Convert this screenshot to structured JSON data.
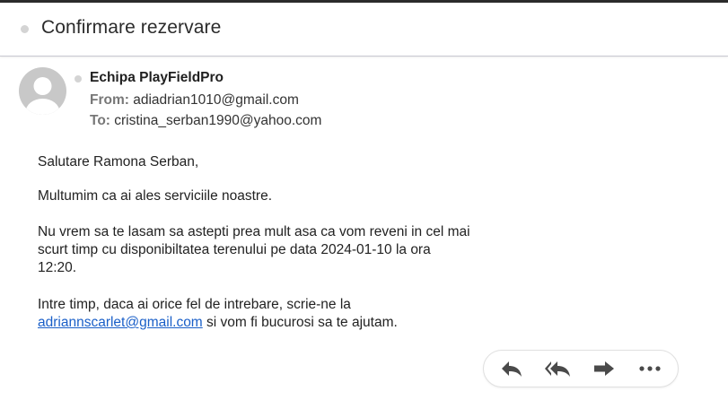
{
  "email": {
    "subject": "Confirmare rezervare",
    "sender_name": "Echipa PlayFieldPro",
    "from_label": "From:",
    "from_value": "adiadrian1010@gmail.com",
    "to_label": "To:",
    "to_value": "cristina_serban1990@yahoo.com",
    "greeting": "Salutare Ramona Serban,",
    "paragraph_thanks": "Multumim ca ai ales serviciile noastre.",
    "paragraph_wait_line1": "Nu vrem sa te lasam sa astepti prea mult asa ca vom reveni in cel mai",
    "paragraph_wait_line2": "scurt timp cu disponibiltatea terenului pe data 2024-01-10 la ora",
    "paragraph_wait_line3": "12:20.",
    "paragraph_contact_line1": "Intre timp, daca ai orice fel de intrebare, scrie-ne la",
    "contact_link": "adriannscarlet@gmail.com",
    "paragraph_contact_tail": " si vom fi bucurosi sa te ajutam."
  },
  "actions": [
    {
      "icon": "reply-icon"
    },
    {
      "icon": "reply-all-icon"
    },
    {
      "icon": "forward-icon"
    },
    {
      "icon": "more-options-icon"
    }
  ],
  "colors": {
    "link": "#1a5fc8",
    "action_icon": "#4a4a4a",
    "avatar_bg": "#c8c8c8"
  }
}
